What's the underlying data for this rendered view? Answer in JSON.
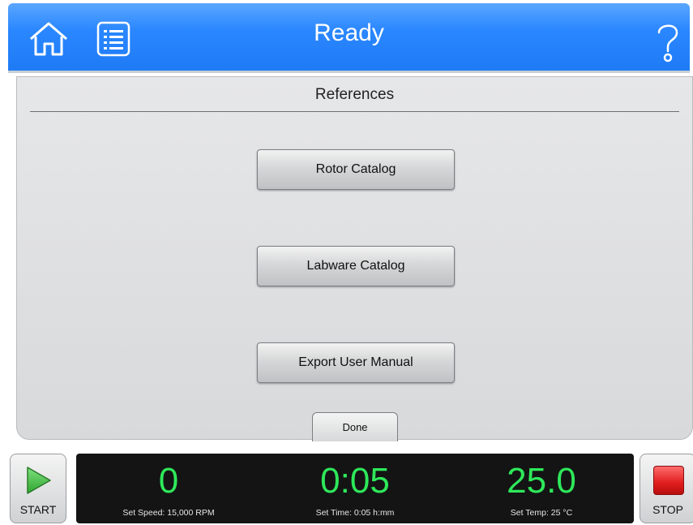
{
  "header": {
    "title": "Ready",
    "home_icon": "home-icon",
    "menu_icon": "list-icon",
    "help_icon": "question-mark-icon",
    "accent_color": "#2a87ff"
  },
  "panel": {
    "title": "References",
    "buttons": {
      "rotor_catalog": "Rotor Catalog",
      "labware_catalog": "Labware Catalog",
      "export_user_manual": "Export User Manual"
    },
    "done_label": "Done"
  },
  "bottom": {
    "start_label": "START",
    "stop_label": "STOP",
    "start_icon": "play-icon",
    "stop_icon": "stop-icon",
    "readout_color": "#2ee85a",
    "speed": {
      "value": "0",
      "set_label": "Set Speed: 15,000 RPM"
    },
    "time": {
      "value": "0:05",
      "set_label": "Set Time: 0:05 h:mm"
    },
    "temp": {
      "value": "25.0",
      "set_label": "Set Temp: 25 °C"
    }
  }
}
